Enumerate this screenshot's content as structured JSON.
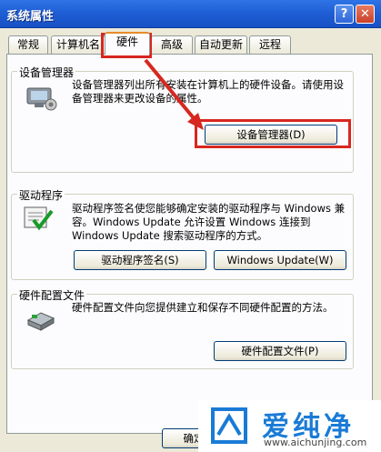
{
  "window": {
    "title": "系统属性",
    "help_glyph": "?",
    "close_glyph": "✕"
  },
  "tabs": [
    {
      "label": "常规"
    },
    {
      "label": "计算机名"
    },
    {
      "label": "硬件"
    },
    {
      "label": "高级"
    },
    {
      "label": "自动更新"
    },
    {
      "label": "远程"
    }
  ],
  "device_manager": {
    "title": "设备管理器",
    "description": "设备管理器列出所有安装在计算机上的硬件设备。请使用设备管理器来更改设备的属性。",
    "button": "设备管理器(D)",
    "icon": "device-manager-icon"
  },
  "driver": {
    "title": "驱动程序",
    "description": "驱动程序签名使您能够确定安装的驱动程序与 Windows 兼容。Windows Update 允许设置 Windows 连接到 Windows Update 搜索驱动程序的方式。",
    "button_sign": "驱动程序签名(S)",
    "button_update": "Windows Update(W)",
    "icon": "driver-signing-icon"
  },
  "hardware_profile": {
    "title": "硬件配置文件",
    "description": "硬件配置文件向您提供建立和保存不同硬件配置的方法。",
    "button": "硬件配置文件(P)",
    "icon": "hardware-profile-icon"
  },
  "footer": {
    "ok_button": "确定"
  },
  "watermark": {
    "brand": "爱纯净",
    "url": "www.aichunjing.com"
  },
  "colors": {
    "annotation_red": "#d7271f",
    "titlebar_blue": "#1f5fd6",
    "watermark_blue": "#1a7bd6"
  }
}
